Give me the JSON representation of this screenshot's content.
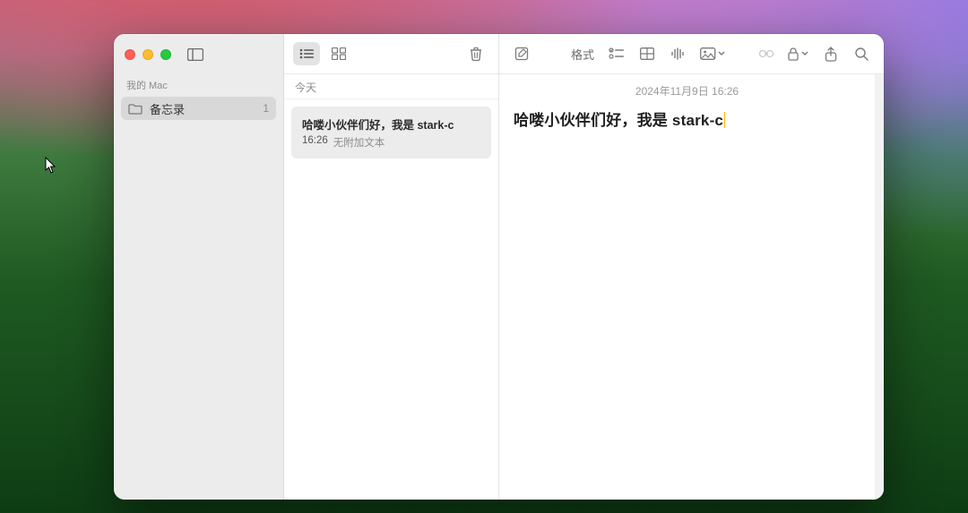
{
  "sidebar": {
    "section_title": "我的 Mac",
    "folders": [
      {
        "name": "备忘录",
        "count": "1"
      }
    ]
  },
  "notes_list": {
    "section": "今天",
    "items": [
      {
        "title": "哈喽小伙伴们好，我是 stark-c",
        "time": "16:26",
        "preview": "无附加文本"
      }
    ]
  },
  "editor": {
    "toolbar": {
      "format_label": "格式"
    },
    "date": "2024年11月9日 16:26",
    "title": "哈喽小伙伴们好，我是 stark-c"
  }
}
